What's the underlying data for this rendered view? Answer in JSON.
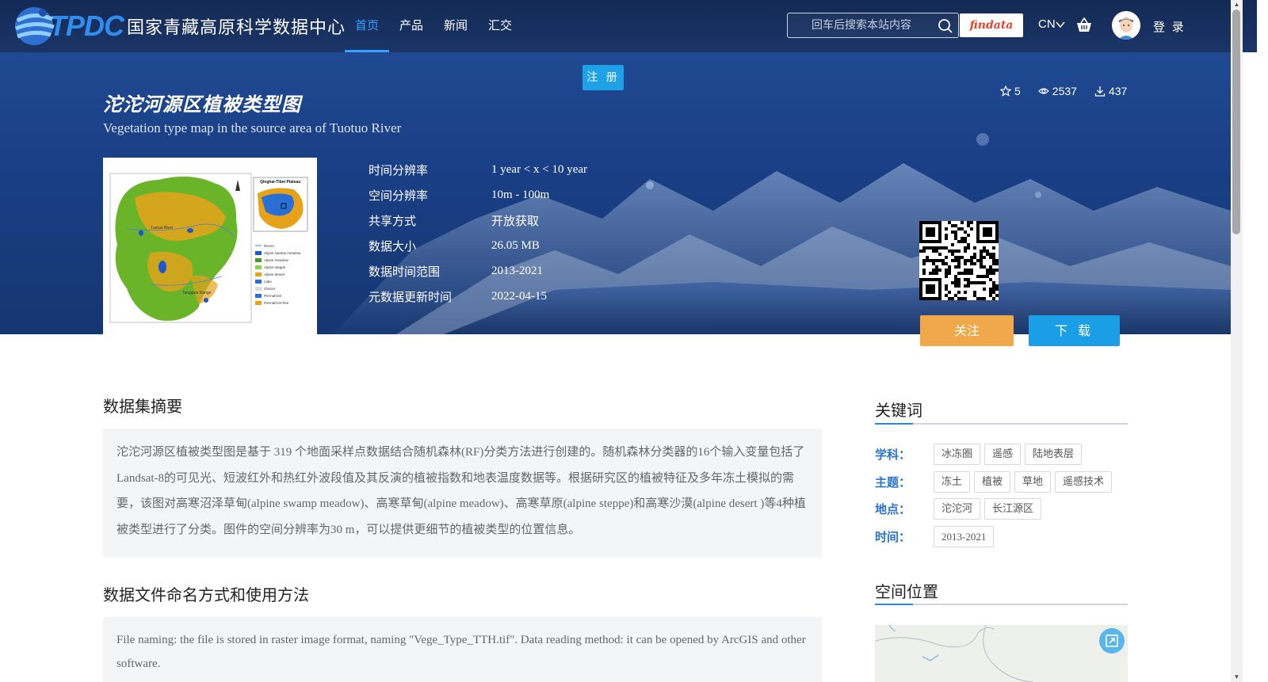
{
  "header": {
    "logo_brand": "TPDC",
    "logo_name": "国家青藏高原科学数据中心",
    "nav": [
      {
        "label": "首页",
        "active": true
      },
      {
        "label": "产品",
        "active": false
      },
      {
        "label": "新闻",
        "active": false
      },
      {
        "label": "汇交",
        "active": false
      }
    ],
    "search_placeholder": "回车后搜索本站内容",
    "findata_label": "findata",
    "lang_label": "CN",
    "login_label": "登 录",
    "register_label": "注 册"
  },
  "dataset": {
    "title_cn": "沱沱河源区植被类型图",
    "title_en": "Vegetation type map in the source area of Tuotuo River",
    "stats": {
      "stars": "5",
      "views": "2537",
      "downloads": "437"
    },
    "meta": [
      {
        "key": "时间分辨率",
        "value": "1 year < x < 10 year"
      },
      {
        "key": "空间分辨率",
        "value": "10m - 100m"
      },
      {
        "key": "共享方式",
        "value": "开放获取"
      },
      {
        "key": "数据大小",
        "value": "26.05 MB"
      },
      {
        "key": "数据时间范围",
        "value": "2013-2021"
      },
      {
        "key": "元数据更新时间",
        "value": "2022-04-15"
      }
    ],
    "follow_label": "关注",
    "download_label": "下 载"
  },
  "thumbnail": {
    "inset_title": "Qinghai-Tibet Plateau",
    "legend": [
      "Rivers",
      "Alpine swamp meadow",
      "Alpine meadow",
      "Alpine steppe",
      "Alpine desert",
      "Lake",
      "Glacier",
      "Permafrost",
      "Permafrost-free"
    ],
    "map_labels": [
      "Tuotuo River",
      "Tanggula Range"
    ]
  },
  "abstract": {
    "heading": "数据集摘要",
    "text": "沱沱河源区植被类型图是基于 319 个地面采样点数据结合随机森林(RF)分类方法进行创建的。随机森林分类器的16个输入变量包括了Landsat-8的可见光、短波红外和热红外波段值及其反演的植被指数和地表温度数据等。根据研究区的植被特征及多年冻土模拟的需要，该图对高寒沼泽草甸(alpine swamp meadow)、高寒草甸(alpine meadow)、高寒草原(alpine steppe)和高寒沙漠(alpine desert )等4种植被类型进行了分类。图件的空间分辨率为30 m，可以提供更细节的植被类型的位置信息。"
  },
  "naming": {
    "heading": "数据文件命名方式和使用方法",
    "text": "File naming: the file is stored in raster image format, naming \"Vege_Type_TTH.tif\". Data reading method: it can be opened by ArcGIS and other software."
  },
  "keywords": {
    "heading": "关键词",
    "rows": [
      {
        "label": "学科：",
        "tags": [
          "冰冻圈",
          "遥感",
          "陆地表层"
        ]
      },
      {
        "label": "主题：",
        "tags": [
          "冻土",
          "植被",
          "草地",
          "遥感技术"
        ]
      },
      {
        "label": "地点：",
        "tags": [
          "沱沱河",
          "长江源区"
        ]
      },
      {
        "label": "时间：",
        "tags": [
          "2013-2021"
        ]
      }
    ]
  },
  "spatial": {
    "heading": "空间位置"
  },
  "colors": {
    "nav_bg": "#142a55",
    "accent_blue": "#1a9ee6",
    "follow_orange": "#f0a84a",
    "keyword_label": "#2a74d0"
  },
  "icons": [
    "search-icon",
    "cart-icon",
    "star-icon",
    "eye-icon",
    "download-icon",
    "chevron-down-icon",
    "expand-icon"
  ]
}
